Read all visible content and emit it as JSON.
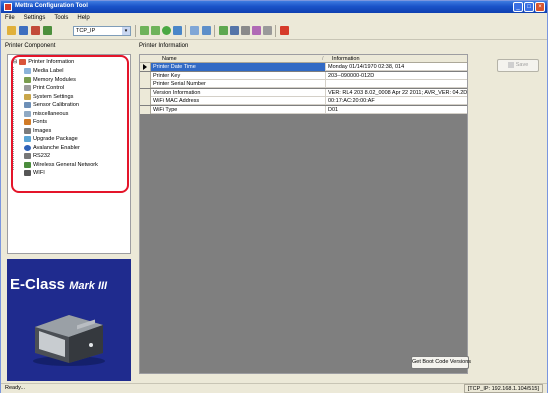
{
  "window": {
    "title": "Mettra Configuration Tool"
  },
  "menu": [
    "File",
    "Settings",
    "Tools",
    "Help"
  ],
  "toolbar": {
    "connection_value": "TCP_IP"
  },
  "left_panel": {
    "header": "Printer Component"
  },
  "right_panel": {
    "header": "Printer Information"
  },
  "tree": {
    "root": "Printer Information",
    "items": [
      {
        "label": "Media Label",
        "icon": "media-label-icon",
        "color": "#8bb3d9"
      },
      {
        "label": "Memory Modules",
        "icon": "memory-icon",
        "color": "#7a9d4f"
      },
      {
        "label": "Print Control",
        "icon": "print-control-icon",
        "color": "#9c9c9c"
      },
      {
        "label": "System Settings",
        "icon": "system-settings-icon",
        "color": "#c9a64a"
      },
      {
        "label": "Sensor Calibration",
        "icon": "sensor-icon",
        "color": "#6d8fb7"
      },
      {
        "label": "miscellaneous",
        "icon": "misc-icon",
        "color": "#8fa9c4"
      },
      {
        "label": "Fonts",
        "icon": "fonts-icon",
        "color": "#d07a26"
      },
      {
        "label": "Images",
        "icon": "images-icon",
        "color": "#7b7b7b"
      },
      {
        "label": "Upgrade Package",
        "icon": "upgrade-icon",
        "color": "#5aa4d4"
      },
      {
        "label": "Avalanche Enabler",
        "icon": "avalanche-icon",
        "color": "#2e62b8"
      },
      {
        "label": "RS232",
        "icon": "rs232-icon",
        "color": "#777777"
      },
      {
        "label": "Wireless General Network",
        "icon": "wireless-icon",
        "color": "#4a8c3c"
      },
      {
        "label": "WIFI",
        "icon": "wifi-icon",
        "color": "#555555"
      }
    ]
  },
  "brand": {
    "text": "E-Class",
    "mark": "Mark III"
  },
  "grid": {
    "columns": [
      "Name",
      "Information"
    ],
    "rows": [
      {
        "name": "Printer Date Time",
        "info": "Monday 01/14/1970 02:38, 014",
        "selected": true
      },
      {
        "name": "Printer Key",
        "info": "203--090000-012D",
        "selected": false
      },
      {
        "name": "Printer Serial Number",
        "info": "",
        "selected": false
      },
      {
        "name": "Version Information",
        "info": "VER: RL4 203 8.02_0008 Apr 22 2011; AVR_VER: 04.2D",
        "selected": false
      },
      {
        "name": "WiFi MAC Address",
        "info": "00:17:AC:20:00:AF",
        "selected": false
      },
      {
        "name": "WiFi Type",
        "info": "D01",
        "selected": false
      }
    ]
  },
  "buttons": {
    "save": "Save",
    "boot_code": "Get Boot Code Versions"
  },
  "status": {
    "left": "Ready...",
    "right": "[TCP_IP: 192.168.1.104/515]"
  },
  "colors": {
    "accent": "#316ac5",
    "highlight": "#e4152a",
    "brand_bg": "#1f2b8e"
  }
}
